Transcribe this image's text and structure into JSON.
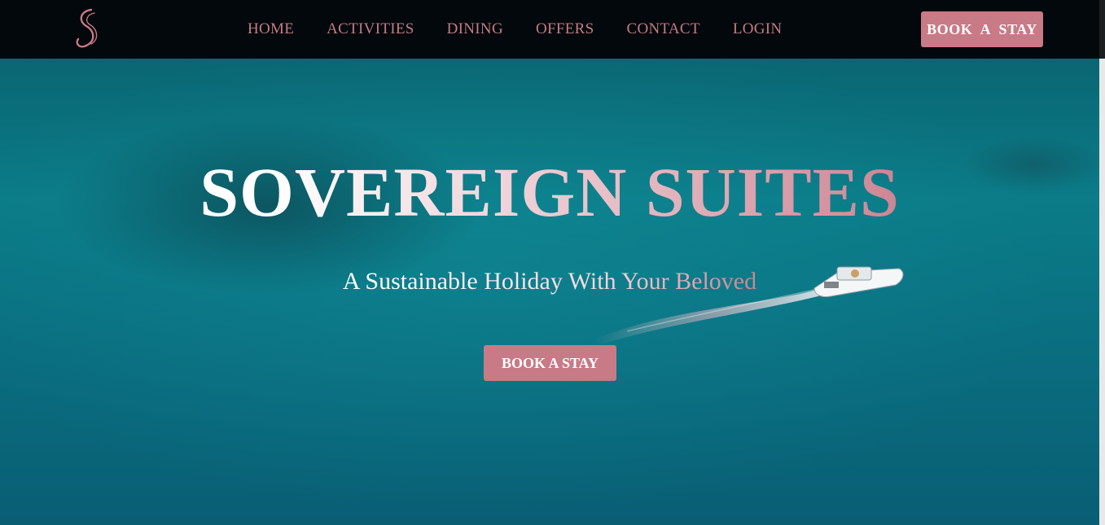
{
  "header": {
    "logo_icon": "script-s-logo-icon",
    "nav": [
      {
        "label": "HOME"
      },
      {
        "label": "ACTIVITIES"
      },
      {
        "label": "DINING"
      },
      {
        "label": "OFFERS"
      },
      {
        "label": "CONTACT"
      },
      {
        "label": "LOGIN"
      }
    ],
    "cta_label": "BOOK  A  STAY"
  },
  "hero": {
    "title": "SOVEREIGN SUITES",
    "subtitle": "A Sustainable Holiday With Your Beloved",
    "cta_label": "BOOK A STAY",
    "background": "aerial-ocean-with-boat",
    "boat_icon": "boat-icon"
  },
  "colors": {
    "accent": "#c87a86",
    "nav_bg": "#02080b",
    "ocean": "#0b7c88"
  }
}
